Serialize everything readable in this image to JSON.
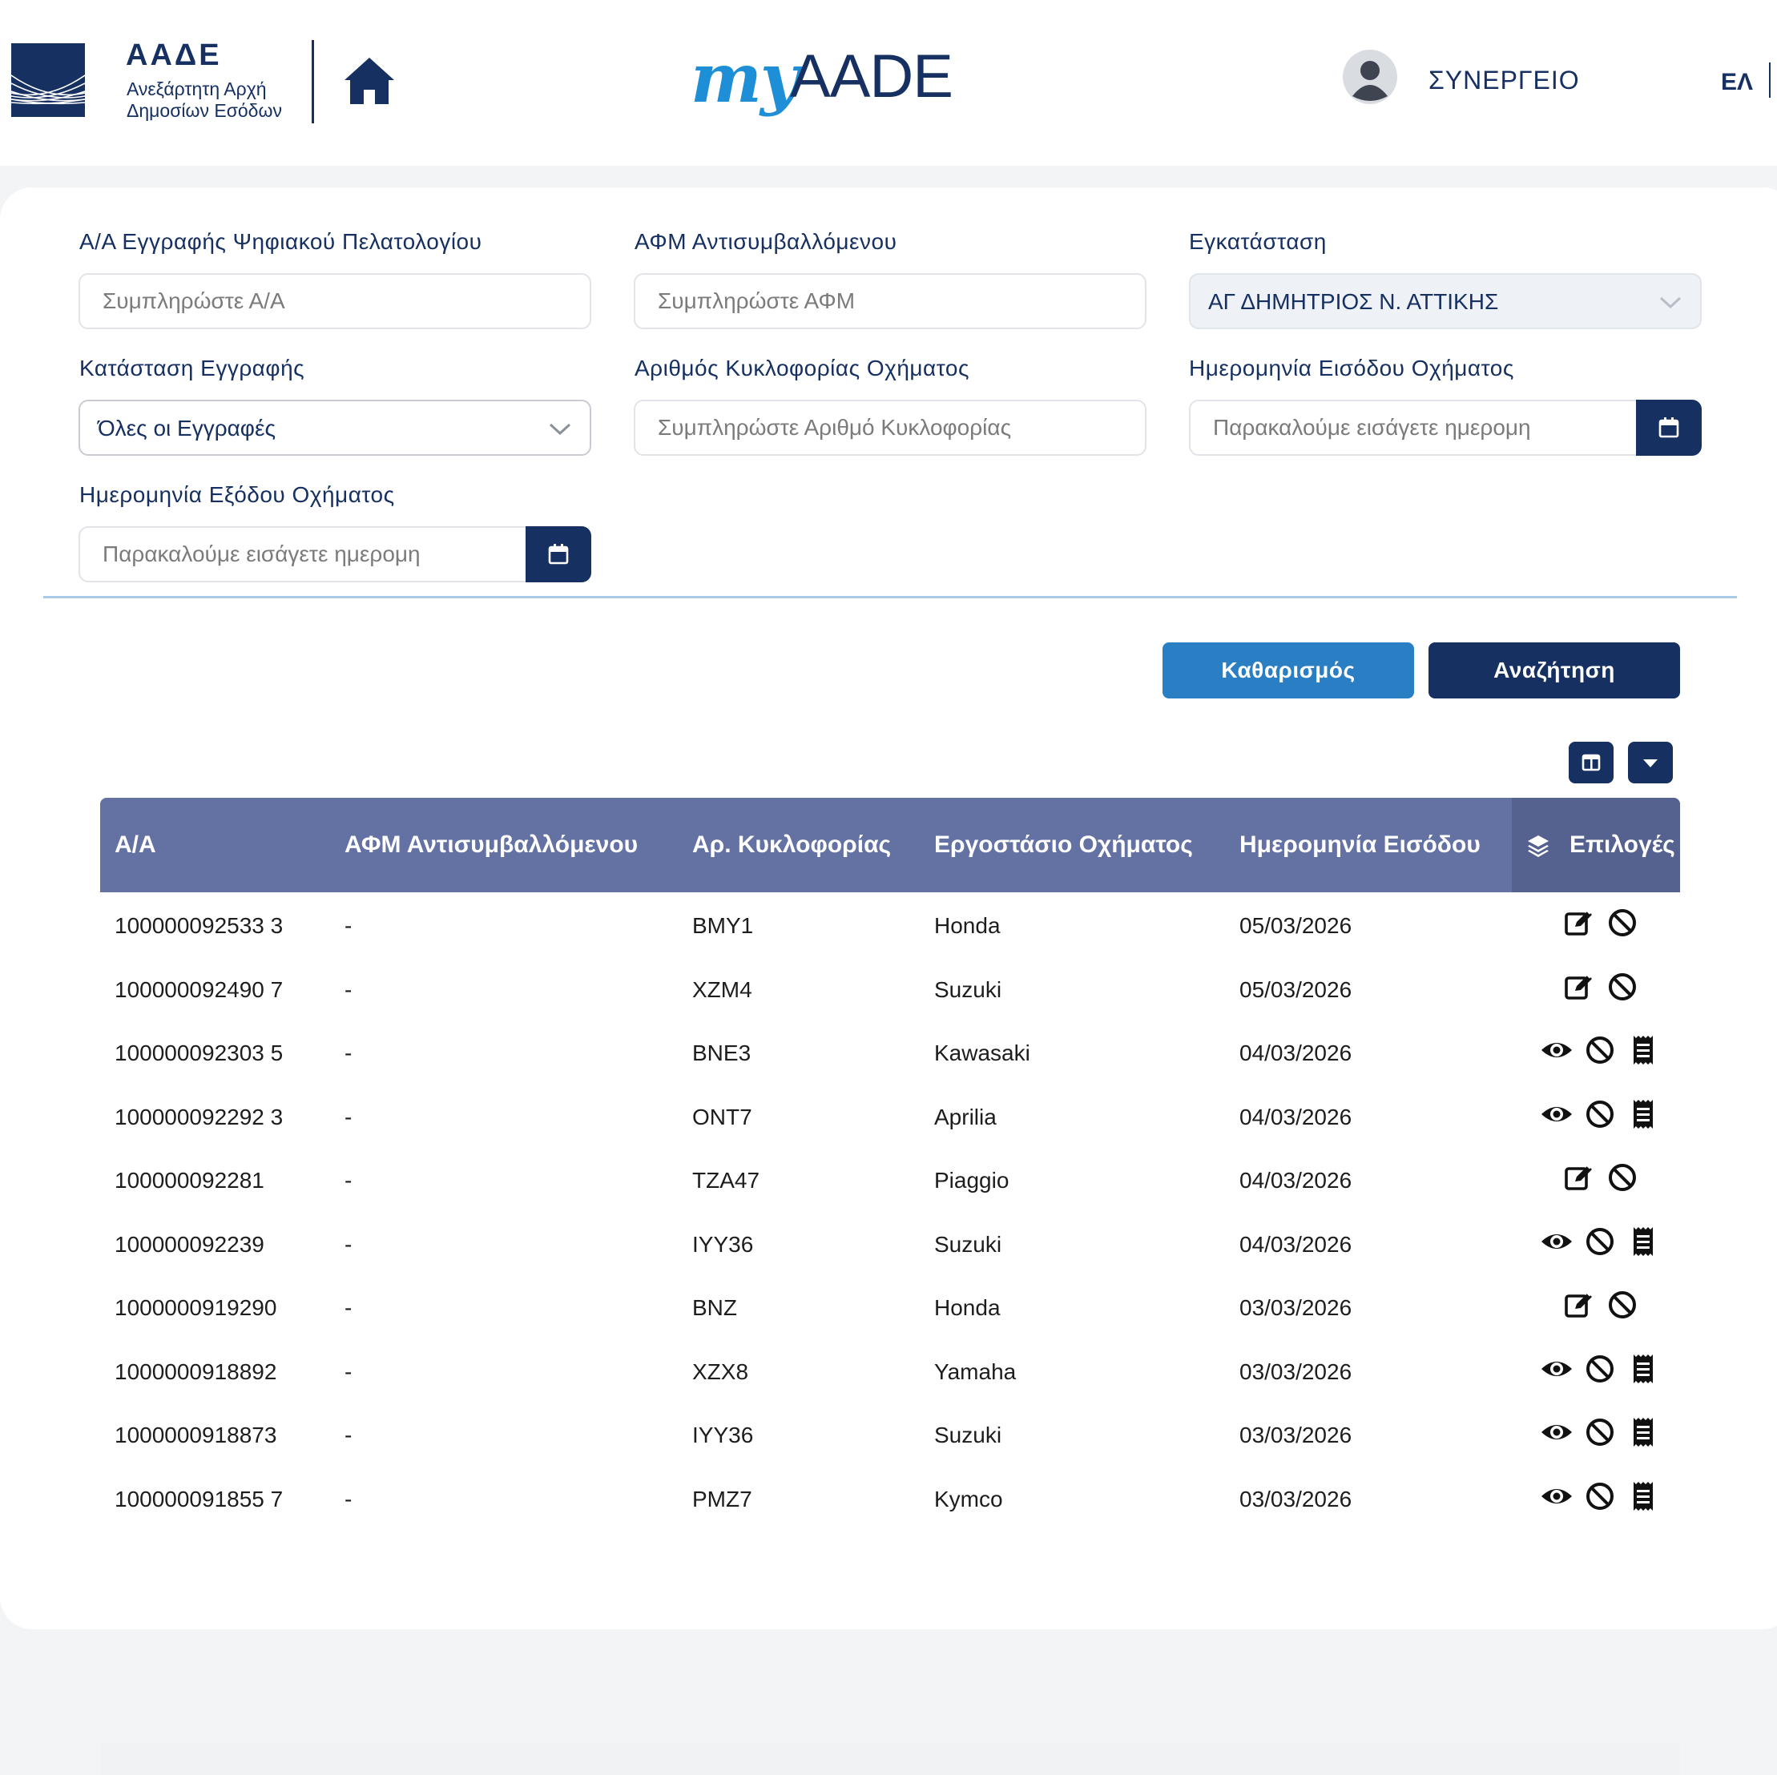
{
  "header": {
    "org_name": "ΑΑΔΕ",
    "org_sub1": "Ανεξάρτητη Αρχή",
    "org_sub2": "Δημοσίων Εσόδων",
    "brand_my": "my",
    "brand_aade": "AADE",
    "user": "ΣΥΝΕΡΓΕΙΟ",
    "language": "ΕΛ"
  },
  "filters": {
    "aa": {
      "label": "Α/Α Εγγραφής Ψηφιακού Πελατολογίου",
      "placeholder": "Συμπληρώστε Α/Α"
    },
    "afm": {
      "label": "ΑΦΜ Αντισυμβαλλόμενου",
      "placeholder": "Συμπληρώστε ΑΦΜ"
    },
    "installation": {
      "label": "Εγκατάσταση",
      "value": "ΑΓ ΔΗΜΗΤΡΙΟΣ Ν. ΑΤΤΙΚΗΣ"
    },
    "status": {
      "label": "Κατάσταση Εγγραφής",
      "value": "Όλες οι Εγγραφές"
    },
    "plate": {
      "label": "Αριθμός Κυκλοφορίας Οχήματος",
      "placeholder": "Συμπληρώστε Αριθμό Κυκλοφορίας"
    },
    "entry_date": {
      "label": "Ημερομηνία Εισόδου Οχήματος",
      "placeholder": "Παρακαλούμε εισάγετε ημερομη"
    },
    "exit_date": {
      "label": "Ημερομηνία Εξόδου Οχήματος",
      "placeholder": "Παρακαλούμε εισάγετε ημερομη"
    }
  },
  "buttons": {
    "clear": "Καθαρισμός",
    "search": "Αναζήτηση"
  },
  "colors": {
    "primary": "#163062",
    "accent": "#2a7fc4",
    "table_header": "#6371a3"
  },
  "table": {
    "columns": [
      "Α/Α",
      "ΑΦΜ Αντισυμβαλλόμενου",
      "Αρ. Κυκλοφορίας",
      "Εργοστάσιο Οχήματος",
      "Ημερομηνία Εισόδου",
      "Επιλογές"
    ],
    "rows": [
      {
        "aa": "100000092533  3",
        "afm": "-",
        "plate": "BMY1",
        "make": "Honda",
        "date": "05/03/2026",
        "actions": [
          "edit",
          "cancel"
        ]
      },
      {
        "aa": "100000092490  7",
        "afm": "-",
        "plate": "XZM4",
        "make": "Suzuki",
        "date": "05/03/2026",
        "actions": [
          "edit",
          "cancel"
        ]
      },
      {
        "aa": "100000092303  5",
        "afm": "-",
        "plate": "BNE3",
        "make": "Kawasaki",
        "date": "04/03/2026",
        "actions": [
          "view",
          "cancel",
          "receipt"
        ]
      },
      {
        "aa": "100000092292  3",
        "afm": "-",
        "plate": "ONT7",
        "make": "Aprilia",
        "date": "04/03/2026",
        "actions": [
          "view",
          "cancel",
          "receipt"
        ]
      },
      {
        "aa": "100000092281",
        "afm": "-",
        "plate": "TZA47",
        "make": "Piaggio",
        "date": "04/03/2026",
        "actions": [
          "edit",
          "cancel"
        ]
      },
      {
        "aa": "100000092239",
        "afm": "-",
        "plate": "IYY36",
        "make": "Suzuki",
        "date": "04/03/2026",
        "actions": [
          "view",
          "cancel",
          "receipt"
        ]
      },
      {
        "aa": "1000000919290",
        "afm": "-",
        "plate": "BNZ",
        "make": "Honda",
        "date": "03/03/2026",
        "actions": [
          "edit",
          "cancel"
        ]
      },
      {
        "aa": "1000000918892",
        "afm": "-",
        "plate": "XZX8",
        "make": "Yamaha",
        "date": "03/03/2026",
        "actions": [
          "view",
          "cancel",
          "receipt"
        ]
      },
      {
        "aa": "1000000918873",
        "afm": "-",
        "plate": "IYY36",
        "make": "Suzuki",
        "date": "03/03/2026",
        "actions": [
          "view",
          "cancel",
          "receipt"
        ]
      },
      {
        "aa": "100000091855  7",
        "afm": "-",
        "plate": "PMZ7",
        "make": "Kymco",
        "date": "03/03/2026",
        "actions": [
          "view",
          "cancel",
          "receipt"
        ]
      }
    ]
  }
}
